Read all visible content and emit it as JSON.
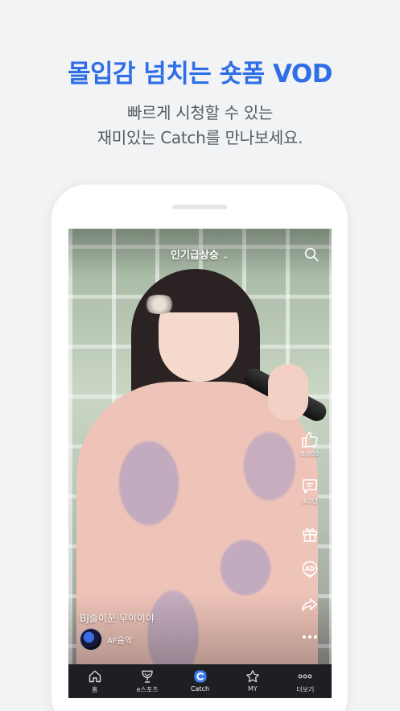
{
  "promo": {
    "headline": "몰입감 넘치는 숏폼 VOD",
    "subline1": "빠르게 시청할 수 있는",
    "subline2": "재미있는 Catch를 만나보세요."
  },
  "screen": {
    "feed_title": "인기급상승",
    "feed_chevron": "⌄",
    "actions": [
      {
        "icon": "thumbs-up-icon",
        "count": "8,888"
      },
      {
        "icon": "comment-icon",
        "count": "3.2만"
      },
      {
        "icon": "gift-icon"
      },
      {
        "icon": "ad-icon",
        "label": "AD"
      },
      {
        "icon": "share-icon"
      },
      {
        "icon": "more-icon"
      }
    ],
    "video_caption": "BJ솔이꾼 무이이야",
    "channel_name": "AF음악"
  },
  "bottom_nav": {
    "items": [
      {
        "icon": "home-icon",
        "label": "홈"
      },
      {
        "icon": "trophy-icon",
        "label": "e스포츠"
      },
      {
        "icon": "catch-icon",
        "label": "Catch",
        "active": true
      },
      {
        "icon": "star-icon",
        "label": "MY"
      },
      {
        "icon": "more-icon",
        "label": "더보기"
      }
    ]
  },
  "colors": {
    "accent": "#2f6fe6",
    "catch_active": "#3f7bf0",
    "nav_bg": "#1e1f22",
    "page_bg": "#f2f3f5"
  }
}
